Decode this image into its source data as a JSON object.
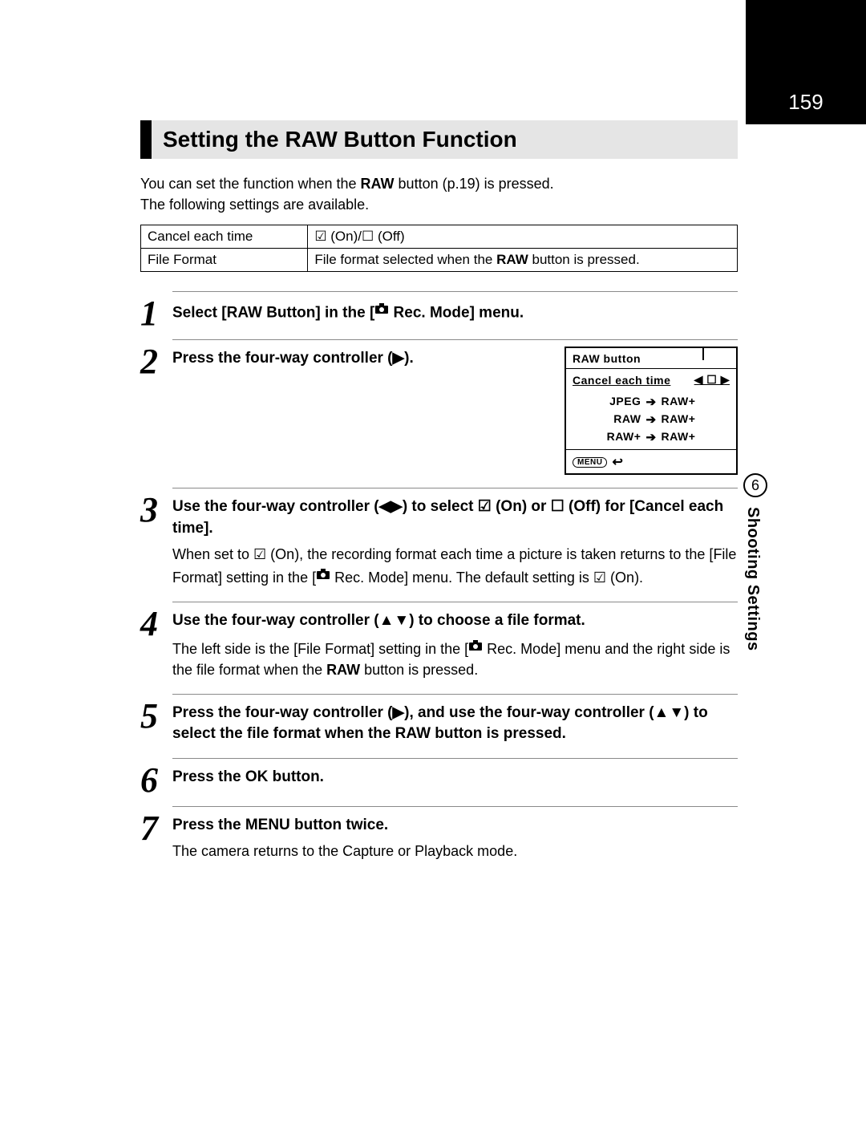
{
  "page_number": "159",
  "side_tab": {
    "number": "6",
    "label": "Shooting Settings"
  },
  "heading": "Setting the RAW Button Function",
  "intro_line1_a": "You can set the function when the ",
  "intro_line1_raw": "RAW",
  "intro_line1_b": " button (p.19) is pressed.",
  "intro_line2": "The following settings are available.",
  "table": {
    "r1c1": "Cancel each time",
    "r1c2": "☑ (On)/☐ (Off)",
    "r2c1": "File Format",
    "r2c2_a": "File format selected when the ",
    "r2c2_raw": "RAW",
    "r2c2_b": " button is pressed."
  },
  "steps": {
    "s1": {
      "num": "1",
      "title_a": "Select [",
      "title_raw": "RAW",
      "title_b": " Button] in the [",
      "title_icon": "📷",
      "title_c": " Rec. Mode] menu."
    },
    "s2": {
      "num": "2",
      "title": "Press the four-way controller (▶)."
    },
    "s3": {
      "num": "3",
      "title": "Use the four-way controller (◀▶) to select ☑ (On) or ☐ (Off) for [Cancel each time].",
      "desc_a": "When set to ☑ (On), the recording format each time a picture is taken returns to the [File Format] setting in the [",
      "desc_icon": "📷",
      "desc_b": " Rec. Mode] menu. The default setting is ☑ (On)."
    },
    "s4": {
      "num": "4",
      "title": "Use the four-way controller (▲▼) to choose a file format.",
      "desc_a": "The left side is the [File Format] setting in the [",
      "desc_icon": "📷",
      "desc_b": " Rec. Mode] menu and the right side is the file format when the ",
      "desc_raw": "RAW",
      "desc_c": " button is pressed."
    },
    "s5": {
      "num": "5",
      "title_a": "Press the four-way controller (▶), and use the four-way controller (▲▼) to select the file format when the ",
      "title_raw": "RAW",
      "title_b": " button is pressed."
    },
    "s6": {
      "num": "6",
      "title_a": "Press the ",
      "title_ok": "OK",
      "title_b": " button."
    },
    "s7": {
      "num": "7",
      "title_a": "Press the ",
      "title_menu": "MENU",
      "title_b": " button twice.",
      "desc": "The camera returns to the Capture or Playback mode."
    }
  },
  "screen": {
    "title": "RAW button",
    "row_label": "Cancel each time",
    "row_ctrl": "◀ ☐ ▶",
    "lines": [
      {
        "l": "JPEG",
        "r": "RAW+"
      },
      {
        "l": "RAW",
        "r": "RAW+"
      },
      {
        "l": "RAW+",
        "r": "RAW+"
      }
    ],
    "footer_menu": "MENU",
    "footer_arrow": "↩"
  }
}
